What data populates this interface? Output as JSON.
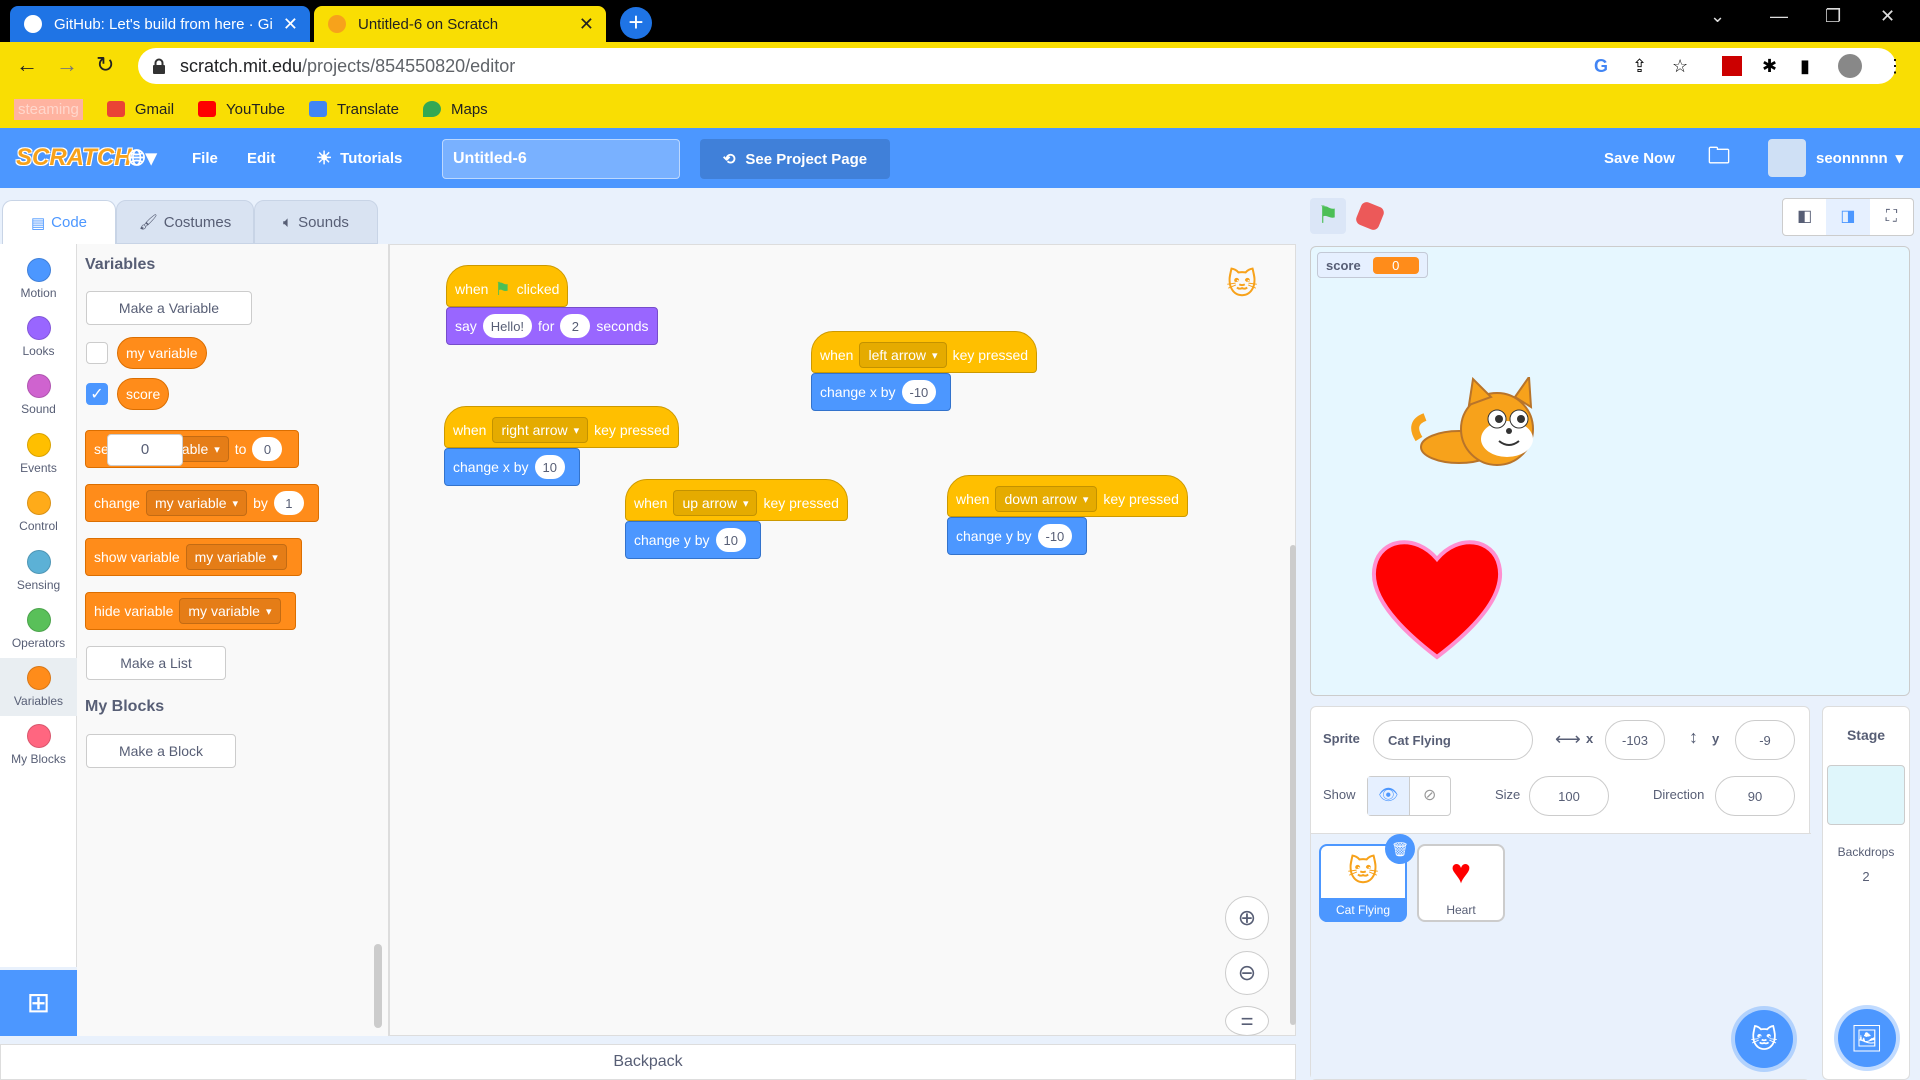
{
  "browser": {
    "tabs": [
      {
        "title": "GitHub: Let's build from here · Gi"
      },
      {
        "title": "Untitled-6 on Scratch"
      }
    ],
    "url_host": "scratch.mit.edu",
    "url_path": "/projects/854550820/editor",
    "bookmarks": [
      {
        "label": "steaming",
        "color": "#ff9aa2"
      },
      {
        "label": "Gmail",
        "color": "#ea4335"
      },
      {
        "label": "YouTube",
        "color": "#ff0000"
      },
      {
        "label": "Translate",
        "color": "#4285f4"
      },
      {
        "label": "Maps",
        "color": "#34a853"
      }
    ]
  },
  "menu": {
    "logo": "SCRATCH",
    "file": "File",
    "edit": "Edit",
    "tutorials": "Tutorials",
    "project_title": "Untitled-6",
    "see_project": "See Project Page",
    "save_now": "Save Now",
    "username": "seonnnnn"
  },
  "editor_tabs": {
    "code": "Code",
    "costumes": "Costumes",
    "sounds": "Sounds"
  },
  "categories": [
    {
      "label": "Motion",
      "color": "#4c97ff"
    },
    {
      "label": "Looks",
      "color": "#9966ff"
    },
    {
      "label": "Sound",
      "color": "#cf63cf"
    },
    {
      "label": "Events",
      "color": "#ffbf00"
    },
    {
      "label": "Control",
      "color": "#ffab19"
    },
    {
      "label": "Sensing",
      "color": "#5cb1d6"
    },
    {
      "label": "Operators",
      "color": "#59c059"
    },
    {
      "label": "Variables",
      "color": "#ff8c1a"
    },
    {
      "label": "My Blocks",
      "color": "#ff6680"
    }
  ],
  "palette": {
    "variables_heading": "Variables",
    "make_variable": "Make a Variable",
    "var1": "my variable",
    "var2": "score",
    "set_word": "se",
    "set_var_partial": "able",
    "set_to": "to",
    "set_val": "0",
    "tooltip_val": "0",
    "change_word": "change",
    "change_var": "my variable",
    "change_by": "by",
    "change_val": "1",
    "show_word": "show variable",
    "show_var": "my variable",
    "hide_word": "hide variable",
    "hide_var": "my variable",
    "make_list": "Make a List",
    "myblocks_heading": "My Blocks",
    "make_block": "Make a Block"
  },
  "scripts": {
    "when": "when",
    "clicked": "clicked",
    "say": "say",
    "hello": "Hello!",
    "for": "for",
    "two": "2",
    "seconds": "seconds",
    "key_pressed": "key pressed",
    "left_arrow": "left arrow",
    "change_x": "change x by",
    "neg10": "-10",
    "right_arrow": "right arrow",
    "ten": "10",
    "up_arrow": "up arrow",
    "change_y": "change y by",
    "down_arrow": "down arrow"
  },
  "backpack": "Backpack",
  "stage": {
    "monitor_label": "score",
    "monitor_value": "0"
  },
  "sprite_info": {
    "sprite_label": "Sprite",
    "sprite_name": "Cat Flying",
    "x_label": "x",
    "x": "-103",
    "y_label": "y",
    "y": "-9",
    "show_label": "Show",
    "size_label": "Size",
    "size": "100",
    "direction_label": "Direction",
    "direction": "90"
  },
  "sprites": [
    {
      "name": "Cat Flying"
    },
    {
      "name": "Heart"
    }
  ],
  "stage_panel": {
    "title": "Stage",
    "backdrops_label": "Backdrops",
    "backdrops_count": "2"
  }
}
